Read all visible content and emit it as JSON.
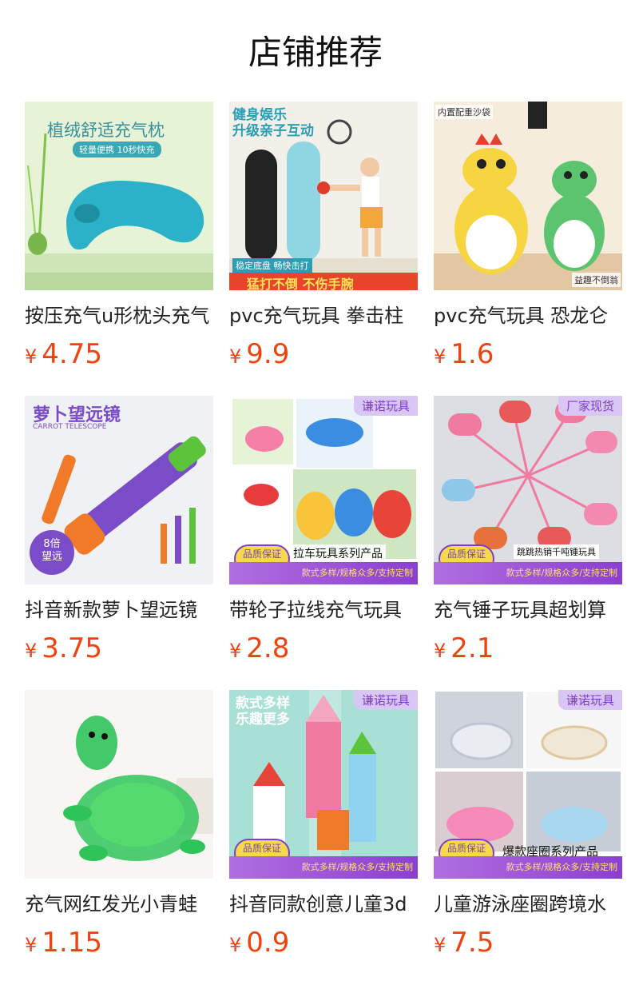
{
  "page": {
    "title": "店铺推荐"
  },
  "currency_symbol": "¥",
  "products": [
    {
      "name": "按压充气u形枕头充气",
      "price": "4.75",
      "image_text": {
        "headline": "植绒舒适充气枕",
        "sub": "轻量便携 10秒快充"
      },
      "colors": {
        "bg": "#dff0cf",
        "item": "#2ab3c9"
      },
      "image": "inflatable-neck-pillow"
    },
    {
      "name": "pvc充气玩具 拳击柱",
      "price": "9.9",
      "image_text": {
        "headline": "健身娱乐",
        "headline2": "升级亲子互动",
        "note": "稳定底盘 畅快击打",
        "bottom": "猛打不倒 不伤手腕"
      },
      "colors": {
        "bg": "#f2efe8",
        "item": "#7fd0df"
      },
      "image": "boxing-bag-toy"
    },
    {
      "name": "pvc充气玩具 恐龙仑",
      "price": "1.6",
      "image_text": {
        "tl": "内置配重沙袋",
        "br": "益趣不倒翁"
      },
      "colors": {
        "bg": "#f4ead8",
        "item": "#f6cf3a"
      },
      "image": "dinosaur-tumbler"
    },
    {
      "name": "抖音新款萝卜望远镜",
      "price": "3.75",
      "image_text": {
        "headline": "萝卜望远镜",
        "sub": "CARROT TELESCOPE",
        "badge": "8倍\n望远"
      },
      "colors": {
        "bg": "#eef0f4",
        "item": "#f07a28"
      },
      "image": "carrot-telescope"
    },
    {
      "name": "带轮子拉线充气玩具",
      "price": "2.8",
      "image_text": {
        "tag": "谦诺玩具",
        "series": "拉车玩具系列产品",
        "strip": "款式多样/规格众多/支持定制"
      },
      "colors": {
        "bg": "#ffffff",
        "item": "#4aa8e8"
      },
      "image": "pull-along-inflatables"
    },
    {
      "name": "充气锤子玩具超划算",
      "price": "2.1",
      "image_text": {
        "tag": "厂家现货",
        "series": "跳跳热销千吨锤玩具",
        "strip": "款式多样/规格众多/支持定制"
      },
      "colors": {
        "bg": "#d9dbe0",
        "item": "#e85a5a"
      },
      "image": "inflatable-hammers"
    },
    {
      "name": "充气网红发光小青蛙",
      "price": "1.15",
      "image_text": {},
      "colors": {
        "bg": "#f6f6f4",
        "item": "#2fc45a"
      },
      "image": "inflatable-turtle"
    },
    {
      "name": "抖音同款创意儿童3d",
      "price": "0.9",
      "image_text": {
        "headline": "款式多样",
        "headline2": "乐趣更多",
        "tag": "谦诺玩具",
        "strip": "款式多样/规格众多/支持定制"
      },
      "colors": {
        "bg": "#a9e0d6",
        "item": "#f07aa0"
      },
      "image": "carrot-knife-toys"
    },
    {
      "name": "儿童游泳座圈跨境水",
      "price": "7.5",
      "image_text": {
        "tag": "谦诺玩具",
        "series": "爆款座圈系列产品",
        "strip": "款式多样/规格众多/支持定制"
      },
      "colors": {
        "bg": "#cfd4da",
        "item": "#f58ab8"
      },
      "image": "swim-seat-rings"
    }
  ],
  "common": {
    "quality_seal": "品质保证"
  }
}
